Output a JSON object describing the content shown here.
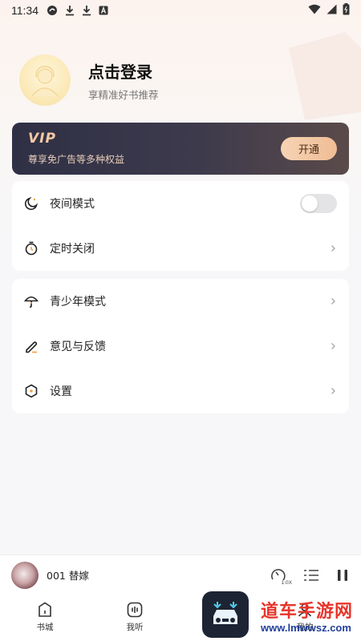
{
  "status_bar": {
    "time": "11:34"
  },
  "profile": {
    "title": "点击登录",
    "subtitle": "享精准好书推荐"
  },
  "vip": {
    "logo": "VIP",
    "desc": "尊享免广告等多种权益",
    "button": "开通",
    "accent": "#f4c9a4"
  },
  "menu_group_1": [
    {
      "label": "夜间模式",
      "icon": "moon-icon",
      "control": "toggle",
      "value": false
    },
    {
      "label": "定时关闭",
      "icon": "timer-icon",
      "control": "chevron"
    }
  ],
  "menu_group_2": [
    {
      "label": "青少年模式",
      "icon": "umbrella-icon",
      "control": "chevron"
    },
    {
      "label": "意见与反馈",
      "icon": "pen-icon",
      "control": "chevron"
    },
    {
      "label": "设置",
      "icon": "settings-icon",
      "control": "chevron"
    }
  ],
  "player": {
    "track": "001 替嫁",
    "speed": "1.0X"
  },
  "bottom_nav": [
    {
      "label": "书城",
      "icon": "bookstore-icon"
    },
    {
      "label": "我听",
      "icon": "listen-icon"
    },
    {
      "label": "我的",
      "icon": "mine-icon"
    }
  ],
  "watermark": {
    "text": "道车手游网",
    "url": "www.lmwwsz.com"
  }
}
